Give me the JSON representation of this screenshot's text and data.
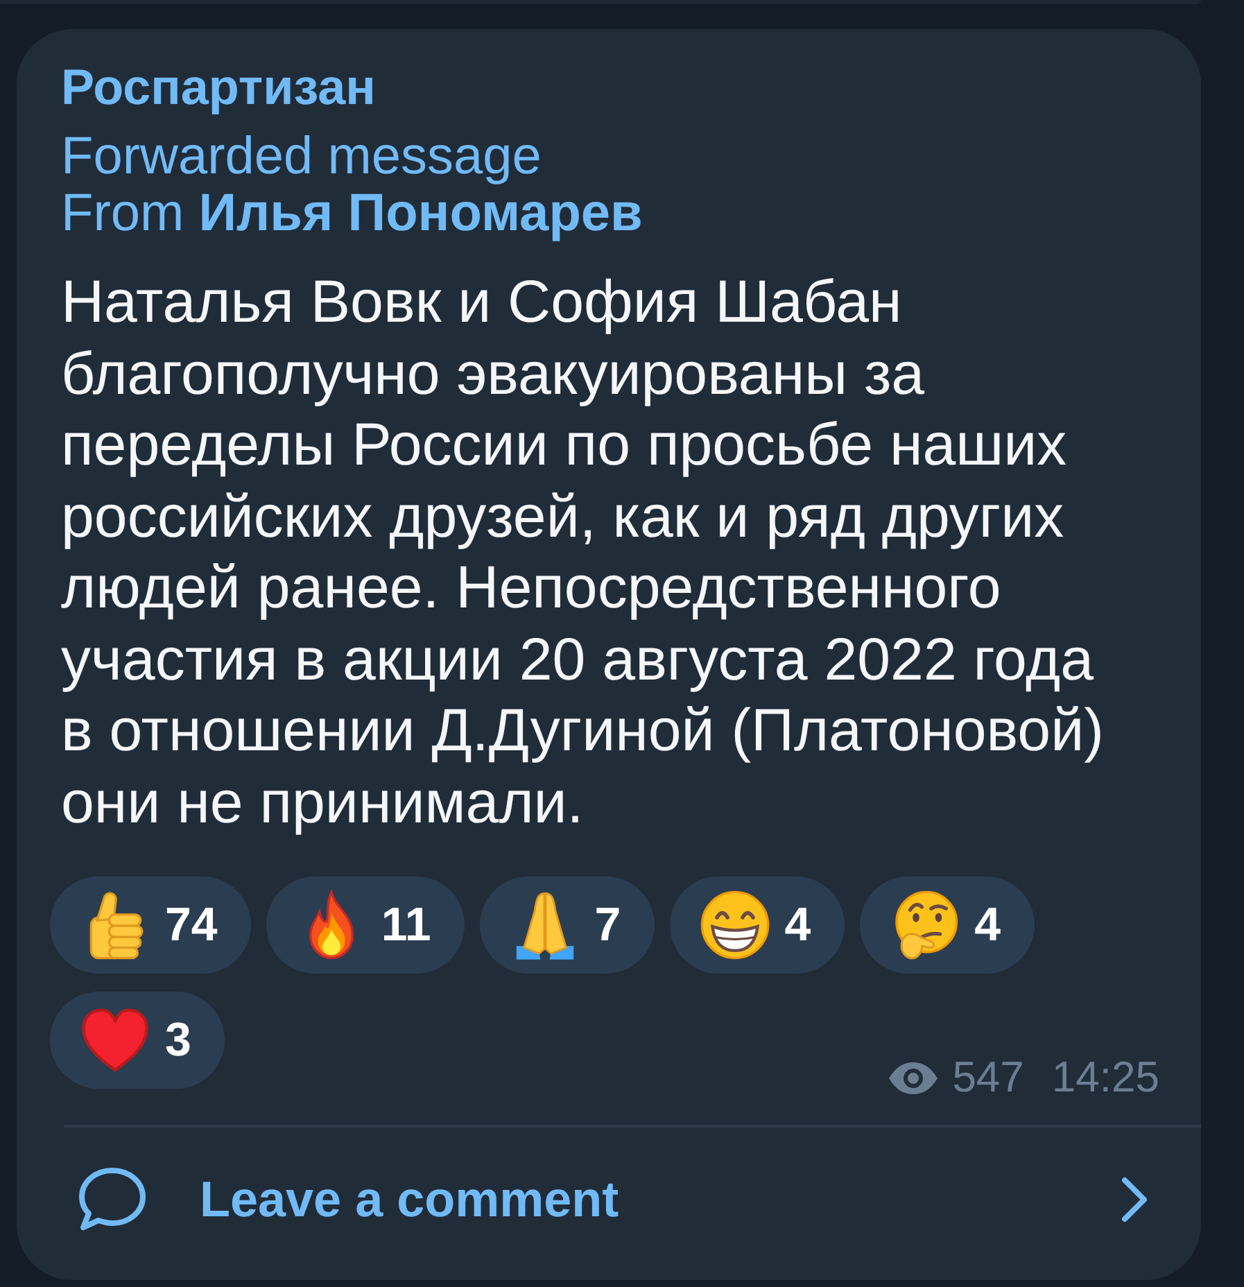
{
  "channel": {
    "name": "Роспартизан"
  },
  "forward": {
    "label": "Forwarded message",
    "from": "From **Илья Пономарев**"
  },
  "message": {
    "text": "Наталья Вовк и София Шабан благополучно эвакуированы за переделы России по просьбе наших российских друзей, как и ряд других людей ранее. Непосредственного участия в акции 20 августа 2022 года в отношении Д.Дугиной (Платоновой) они не принимали."
  },
  "reactions": [
    {
      "kind": "thumbs_up",
      "count": "74",
      "selected": false
    },
    {
      "kind": "fire",
      "count": "11",
      "selected": false
    },
    {
      "kind": "praying_hands",
      "count": "7",
      "selected": false
    },
    {
      "kind": "grinning_face",
      "count": "4",
      "selected": false
    },
    {
      "kind": "thinking_face",
      "count": "4",
      "selected": false
    },
    {
      "kind": "heart",
      "count": "3",
      "selected": false
    }
  ],
  "meta": {
    "views": "547",
    "time": "14:25"
  },
  "comments": {
    "label": "Leave a comment"
  }
}
